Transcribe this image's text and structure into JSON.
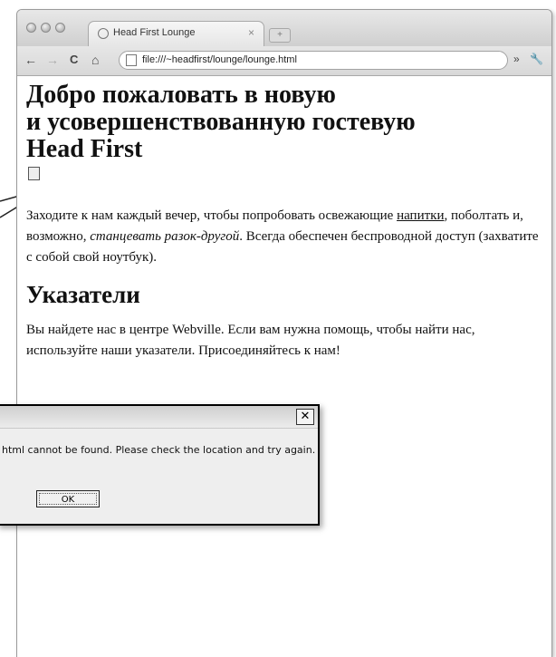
{
  "browser": {
    "tab_title": "Head First Lounge",
    "tab_close": "×",
    "url": "file:///~headfirst/lounge/lounge.html",
    "nav": {
      "back": "←",
      "forward": "→",
      "reload": "C",
      "home": "⌂"
    },
    "menu_chevrons": "»",
    "wrench": "🔧"
  },
  "page": {
    "heading_line1": "Добро пожаловать в новую",
    "heading_line2": "и усовершенствованную гостевую",
    "heading_line3": "Head First",
    "intro_text_a": "Заходите к нам каждый вечер, чтобы попробовать освежающие",
    "intro_link": "напитки",
    "intro_text_b": ", поболтать и, возможно, ",
    "intro_em": "станцевать разок-другой",
    "intro_text_c": ". Всегда обеспечен беспроводной доступ (захватите с собой свой ноутбук).",
    "directions_heading": "Указатели",
    "directions_text": "Вы найдете нас в центре Webville. Если вам нужна помощь, чтобы найти нас, используйте наши указатели. Присоединяйтесь к нам!"
  },
  "dialog": {
    "close": "✕",
    "message": "html cannot be found. Please check the location and try again.",
    "ok_label": "OK"
  }
}
